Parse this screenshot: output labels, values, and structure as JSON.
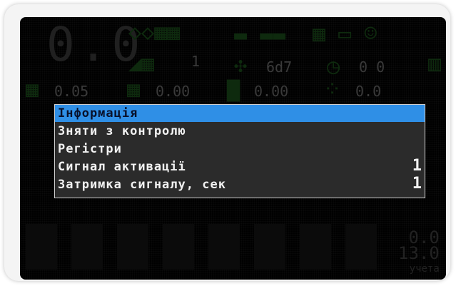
{
  "background": {
    "speed": "0.0",
    "counter": "1",
    "field_code": "6d7",
    "clock_value": "0 0",
    "readout_1": "0.05",
    "readout_2": "0.00",
    "readout_3": "0.00",
    "readout_4": "0.0",
    "bottom_right": [
      "0.0",
      "13.0",
      "учета"
    ]
  },
  "menu": {
    "items": [
      {
        "label": "Інформація",
        "value": "",
        "selected": true
      },
      {
        "label": "Зняти з контролю",
        "value": "",
        "selected": false
      },
      {
        "label": "Регістри",
        "value": "",
        "selected": false
      },
      {
        "label": "Сигнал активації",
        "value": "1",
        "selected": false
      },
      {
        "label": "Затримка сигналу, сек",
        "value": "1",
        "selected": false
      }
    ]
  },
  "colors": {
    "selected_bg": "#2f8fe6",
    "menu_bg": "#2b2b2b",
    "menu_text": "#f2f2f2",
    "icon_dim": "#0e2a0e"
  }
}
